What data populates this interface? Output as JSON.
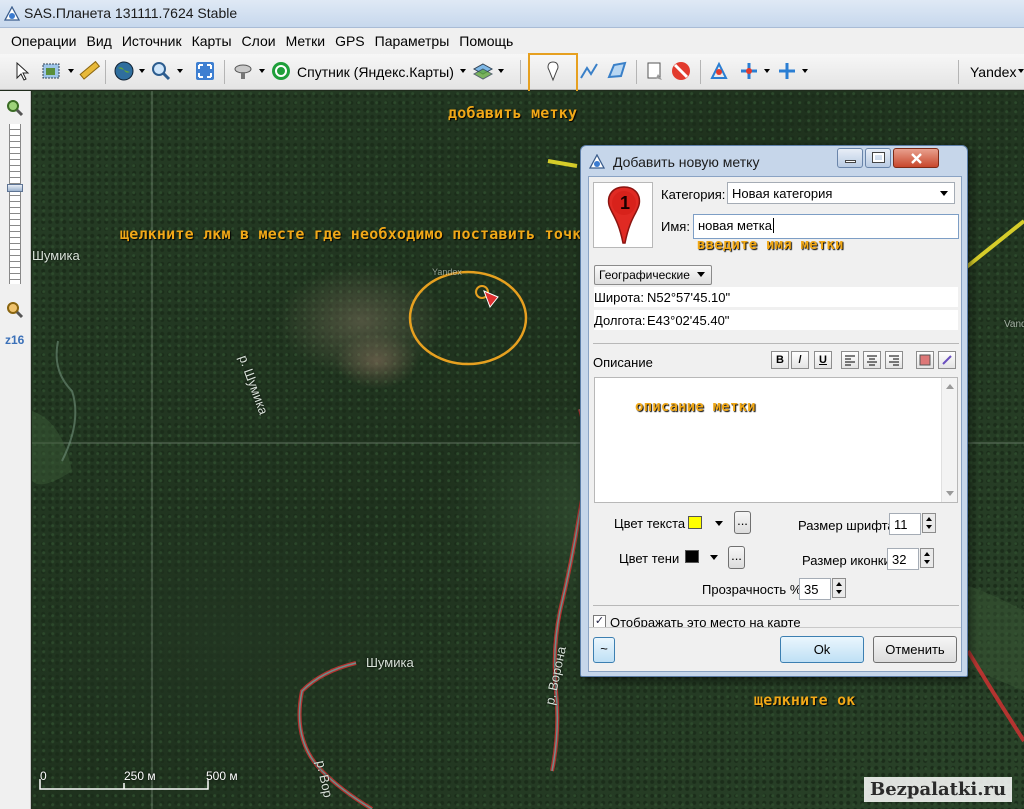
{
  "window": {
    "title": "SAS.Планета 131111.7624 Stable"
  },
  "menu": [
    "Операции",
    "Вид",
    "Источник",
    "Карты",
    "Слои",
    "Метки",
    "GPS",
    "Параметры",
    "Помощь"
  ],
  "toolbar": {
    "map_source": "Спутник (Яндекс.Карты)",
    "right_source": "Yandex"
  },
  "zoom": {
    "level": "z16"
  },
  "map": {
    "labels": {
      "shumika_left": "Шумика",
      "river_shumika": "р. Шумика",
      "shumika_bottom": "Шумика",
      "river_vorona": "р. Ворона",
      "river_vor": "р. Вор",
      "yandex_watermark": "Yandex",
      "vand": "Vand"
    },
    "scale": {
      "zero": "0",
      "mid": "250 м",
      "max": "500 м"
    },
    "watermark": "Bezpalatki.ru"
  },
  "annotations": {
    "add_mark": "добавить метку",
    "click_lkm": "щелкните лкм в месте где необходимо поставить точку",
    "enter_name": "введите имя метки",
    "description": "описание метки",
    "click_ok": "щелкните ок"
  },
  "dialog": {
    "title": "Добавить новую метку",
    "category_label": "Категория:",
    "category_value": "Новая категория",
    "name_label": "Имя:",
    "name_value": "новая метка",
    "coord_format": "Географические",
    "lat_label": "Широта:",
    "lat_value": "N52°57'45.10\"",
    "lon_label": "Долгота:",
    "lon_value": "E43°02'45.40\"",
    "description_label": "Описание",
    "format_buttons": {
      "bold": "B",
      "italic": "/",
      "underline": "U"
    },
    "text_color_label": "Цвет текста",
    "shadow_color_label": "Цвет тени",
    "font_size_label": "Размер шрифта",
    "font_size_value": "11",
    "icon_size_label": "Размер иконки",
    "icon_size_value": "32",
    "opacity_label": "Прозрачность %",
    "opacity_value": "35",
    "show_on_map_label": "Отображать это место на карте",
    "more_button": "...",
    "extra_button": "~",
    "ok_button": "Ok",
    "cancel_button": "Отменить",
    "pin_number": "1",
    "text_color": "#ffff00",
    "shadow_color": "#000000"
  }
}
